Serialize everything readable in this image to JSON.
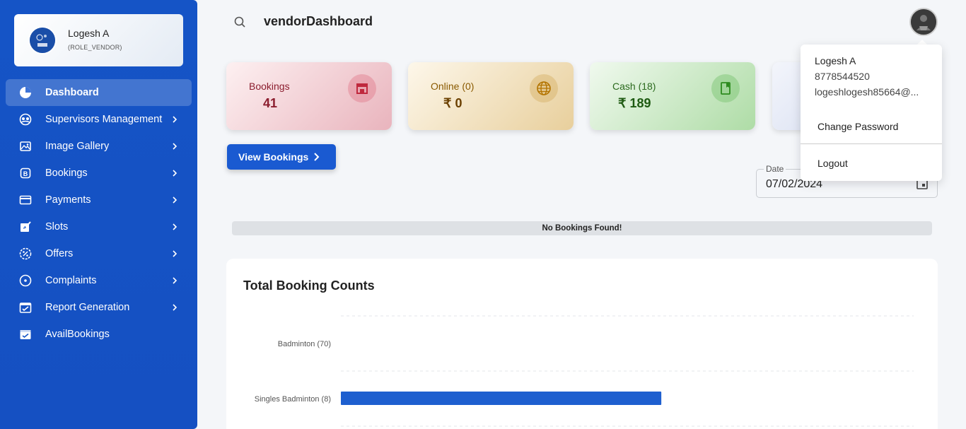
{
  "profile": {
    "name": "Logesh A",
    "role": "(ROLE_VENDOR)"
  },
  "header": {
    "title": "vendorDashboard"
  },
  "sidebar": {
    "items": [
      {
        "label": "Dashboard",
        "icon": "pie-chart-icon",
        "active": true
      },
      {
        "label": "Supervisors Management",
        "icon": "supervisor-icon"
      },
      {
        "label": "Image Gallery",
        "icon": "gallery-icon"
      },
      {
        "label": "Bookings",
        "icon": "bookings-icon"
      },
      {
        "label": "Payments",
        "icon": "credit-card-icon"
      },
      {
        "label": "Slots",
        "icon": "edit-icon"
      },
      {
        "label": "Offers",
        "icon": "discount-icon"
      },
      {
        "label": "Complaints",
        "icon": "circle-dot-icon"
      },
      {
        "label": "Report Generation",
        "icon": "report-icon"
      },
      {
        "label": "AvailBookings",
        "icon": "calendar-check-icon"
      }
    ]
  },
  "stats": {
    "bookings": {
      "label": "Bookings",
      "value": "41"
    },
    "online": {
      "label": "Online (0)",
      "value": "₹ 0"
    },
    "cash": {
      "label": "Cash (18)",
      "value": "₹ 189"
    }
  },
  "view_bookings_label": "View Bookings",
  "date_filter": {
    "legend": "Date",
    "value": "07/02/2024"
  },
  "no_bookings_text": "No Bookings Found!",
  "chart_data": {
    "type": "bar",
    "orientation": "horizontal",
    "title": "Total Booking Counts",
    "categories": [
      "Badminton (70)",
      "Singles Badminton (8)"
    ],
    "values": [
      0,
      8
    ],
    "color": "#1e5fcf",
    "grid": true
  },
  "user_menu": {
    "name": "Logesh A",
    "phone": "8778544520",
    "email": "logeshlogesh85664@...",
    "change_password": "Change Password",
    "logout": "Logout"
  },
  "colors": {
    "sidebar": "#1554c6",
    "primary": "#1a5ad1"
  }
}
